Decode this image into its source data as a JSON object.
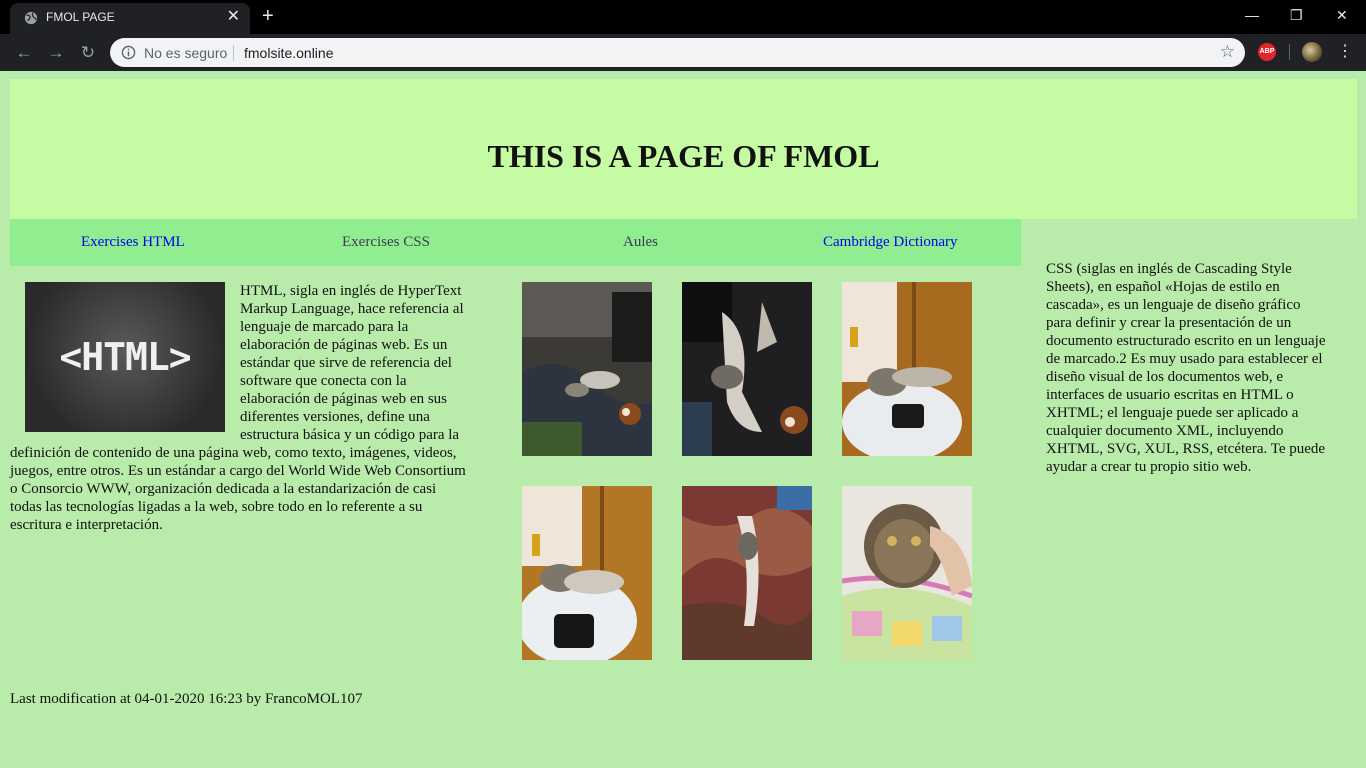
{
  "browser": {
    "tab_title": "FMOL PAGE",
    "security_label": "No es seguro",
    "url": "fmolsite.online",
    "extension_label": "ABP"
  },
  "page": {
    "title": "THIS IS A PAGE OF FMOL",
    "nav": [
      {
        "label": "Exercises HTML",
        "state": "link"
      },
      {
        "label": "Exercises CSS",
        "state": "visited"
      },
      {
        "label": "Aules",
        "state": "visited"
      },
      {
        "label": "Cambridge Dictionary",
        "state": "link"
      }
    ],
    "html_logo_text": "<HTML>",
    "article_text": "HTML, sigla en inglés de HyperText Markup Language, hace referencia al lenguaje de marcado para la elaboración de páginas web. Es un estándar que sirve de referencia del software que conecta con la elaboración de páginas web en sus diferentes versiones, define una estructura básica y un código para la definición de contenido de una página web, como texto, imágenes, videos, juegos, entre otros. Es un estándar a cargo del World Wide Web Consortium o Consorcio WWW, organización dedicada a la estandarización de casi todas las tecnologías ligadas a la web, sobre todo en lo referente a su escritura e interpretación.",
    "aside_text": "CSS (siglas en inglés de Cascading Style Sheets), en español «Hojas de estilo en cascada», es un lenguaje de diseño gráfico para definir y crear la presentación de un documento estructurado escrito en un lenguaje de marcado.2 Es muy usado para establecer el diseño visual de los documentos web, e interfaces de usuario escritas en HTML o XHTML; el lenguaje puede ser aplicado a cualquier documento XML, incluyendo XHTML, SVG, XUL, RSS, etcétera. Te puede ayudar a crear tu propio sitio web.",
    "footer_text": "Last modification at 04-01-2020 16:23 by FrancoMOL107"
  },
  "colors": {
    "page_bg": "#b9ebaa",
    "header_bg": "#c5fba2",
    "nav_bg": "#90ee90",
    "link": "#0000ee",
    "visited": "#3d3d52"
  },
  "icons": [
    "globe-icon",
    "close-icon",
    "plus-icon",
    "minimize-icon",
    "maximize-icon",
    "back-icon",
    "forward-icon",
    "reload-icon",
    "info-icon",
    "star-icon",
    "adblock-icon",
    "avatar",
    "menu-icon"
  ]
}
